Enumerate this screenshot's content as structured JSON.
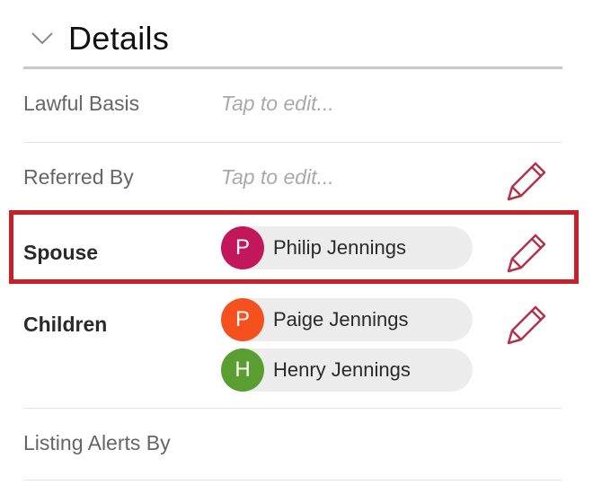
{
  "section": {
    "title": "Details",
    "expanded_icon": "chevron-down-icon"
  },
  "fields": {
    "lawful_basis": {
      "label": "Lawful Basis",
      "placeholder": "Tap to edit..."
    },
    "referred_by": {
      "label": "Referred By",
      "placeholder": "Tap to edit...",
      "edit_icon": "pencil-icon"
    },
    "spouse": {
      "label": "Spouse",
      "people": [
        {
          "initial": "P",
          "name": "Philip Jennings",
          "avatar_color": "#c2185b"
        }
      ],
      "edit_icon": "pencil-icon"
    },
    "children": {
      "label": "Children",
      "people": [
        {
          "initial": "P",
          "name": "Paige Jennings",
          "avatar_color": "#f4511e"
        },
        {
          "initial": "H",
          "name": "Henry Jennings",
          "avatar_color": "#5a9e31"
        }
      ],
      "edit_icon": "pencil-icon"
    },
    "listing_alerts_by": {
      "label": "Listing Alerts By"
    }
  },
  "colors": {
    "accent_icon": "#b0334a",
    "highlight": "#c8202a",
    "chip_background": "#ececec"
  }
}
